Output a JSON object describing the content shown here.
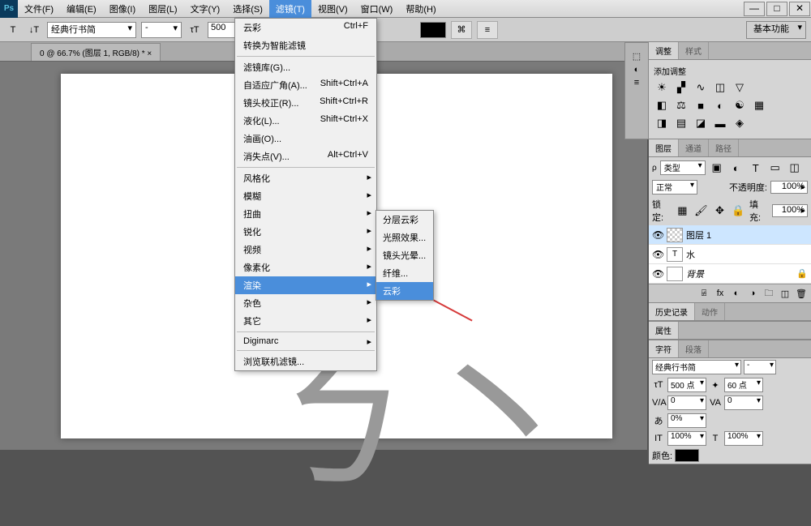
{
  "menubar": [
    "文件(F)",
    "编辑(E)",
    "图像(I)",
    "图层(L)",
    "文字(Y)",
    "选择(S)",
    "滤镜(T)",
    "视图(V)",
    "窗口(W)",
    "帮助(H)"
  ],
  "active_menu_index": 6,
  "optionbar": {
    "font": "经典行书简",
    "style": "-",
    "size_prefix": "500",
    "workspace": "基本功能"
  },
  "doc_tab": "0 @ 66.7% (图层 1, RGB/8) * ×",
  "filter_menu": [
    {
      "label": "云彩",
      "shortcut": "Ctrl+F"
    },
    {
      "label": "转换为智能滤镜"
    },
    {
      "sep": true
    },
    {
      "label": "滤镜库(G)..."
    },
    {
      "label": "自适应广角(A)...",
      "shortcut": "Shift+Ctrl+A"
    },
    {
      "label": "镜头校正(R)...",
      "shortcut": "Shift+Ctrl+R"
    },
    {
      "label": "液化(L)...",
      "shortcut": "Shift+Ctrl+X"
    },
    {
      "label": "油画(O)..."
    },
    {
      "label": "消失点(V)...",
      "shortcut": "Alt+Ctrl+V"
    },
    {
      "sep": true
    },
    {
      "label": "风格化",
      "arrow": true
    },
    {
      "label": "模糊",
      "arrow": true
    },
    {
      "label": "扭曲",
      "arrow": true
    },
    {
      "label": "锐化",
      "arrow": true
    },
    {
      "label": "视频",
      "arrow": true
    },
    {
      "label": "像素化",
      "arrow": true
    },
    {
      "label": "渲染",
      "arrow": true,
      "hover": true
    },
    {
      "label": "杂色",
      "arrow": true
    },
    {
      "label": "其它",
      "arrow": true
    },
    {
      "sep": true
    },
    {
      "label": "Digimarc",
      "arrow": true
    },
    {
      "sep": true
    },
    {
      "label": "浏览联机滤镜..."
    }
  ],
  "render_submenu": [
    "分层云彩",
    "光照效果...",
    "镜头光晕...",
    "纤维...",
    "云彩"
  ],
  "render_submenu_hover": 4,
  "panels": {
    "adjust_tab": "调整",
    "style_tab": "样式",
    "adjust_title": "添加调整",
    "layers_tab": "图层",
    "channels_tab": "通道",
    "paths_tab": "路径",
    "kind_label": "类型",
    "blend": "正常",
    "opacity_label": "不透明度:",
    "opacity_val": "100%",
    "lock_label": "锁定:",
    "fill_label": "填充:",
    "fill_val": "100%",
    "layers": [
      {
        "name": "图层 1",
        "type": "checker"
      },
      {
        "name": "水",
        "type": "T"
      },
      {
        "name": "背景",
        "type": "bg",
        "locked": true
      }
    ],
    "history_tab": "历史记录",
    "actions_tab": "动作",
    "props_tab": "属性",
    "char_tab": "字符",
    "para_tab": "段落",
    "char_font": "经典行书简",
    "char_style": "-",
    "size_val": "500 点",
    "leading_val": "60 点",
    "va_val": "0",
    "kern_val": "0",
    "scale_val": "0%",
    "it_val": "100%",
    "tt_val": "100%",
    "color_label": "颜色:"
  }
}
